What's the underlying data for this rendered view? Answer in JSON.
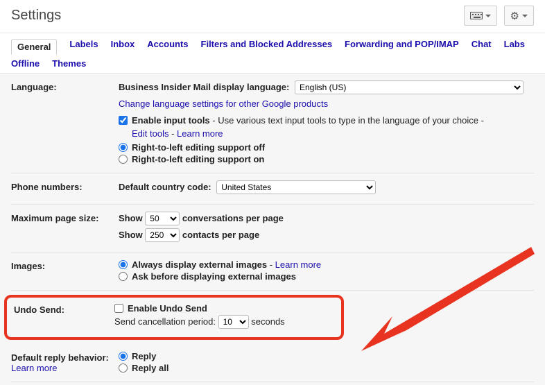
{
  "header": {
    "title": "Settings"
  },
  "tabs": [
    "General",
    "Labels",
    "Inbox",
    "Accounts",
    "Filters and Blocked Addresses",
    "Forwarding and POP/IMAP",
    "Chat",
    "Labs",
    "Offline",
    "Themes"
  ],
  "active_tab": "General",
  "language": {
    "label": "Language:",
    "display_label": "Business Insider Mail display language:",
    "display_value": "English (US)",
    "change_link": "Change language settings for other Google products",
    "enable_input_tools_label": "Enable input tools",
    "enable_input_tools_desc": " - Use various text input tools to type in the language of your choice - ",
    "edit_tools": "Edit tools",
    "dash": " - ",
    "learn_more": "Learn more",
    "rtl_off": "Right-to-left editing support off",
    "rtl_on": "Right-to-left editing support on"
  },
  "phone": {
    "label": "Phone numbers:",
    "default_country_label": "Default country code:",
    "default_country_value": "United States"
  },
  "page_size": {
    "label": "Maximum page size:",
    "show1": "Show",
    "show2": "Show",
    "conversations_value": "50",
    "conversations_suffix": "conversations per page",
    "contacts_value": "250",
    "contacts_suffix": "contacts per page"
  },
  "images": {
    "label": "Images:",
    "always": "Always display external images",
    "dash": " - ",
    "learn_more": "Learn more",
    "ask": "Ask before displaying external images"
  },
  "undo": {
    "label": "Undo Send:",
    "enable": "Enable Undo Send",
    "period_label": "Send cancellation period:",
    "period_value": "10",
    "period_suffix": "seconds"
  },
  "reply": {
    "label": "Default reply behavior:",
    "learn_more": "Learn more",
    "reply": "Reply",
    "reply_all": "Reply all"
  }
}
